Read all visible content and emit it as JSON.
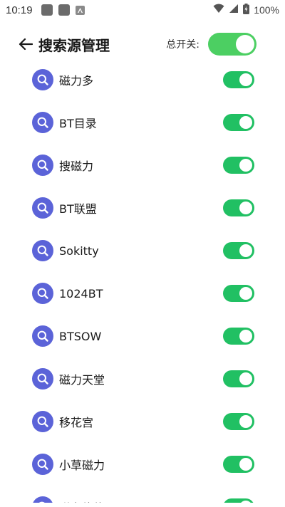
{
  "status_bar": {
    "time": "10:19",
    "battery": "100%"
  },
  "header": {
    "title": "搜索源管理",
    "master_label": "总开关:",
    "master_on": true
  },
  "colors": {
    "toggle_on": "#21c063",
    "master_toggle_on": "#4ccf62",
    "source_icon": "#5b63d8"
  },
  "sources": [
    {
      "name": "磁力多",
      "icon": "search-icon",
      "enabled": true
    },
    {
      "name": "BT目录",
      "icon": "search-icon",
      "enabled": true
    },
    {
      "name": "搜磁力",
      "icon": "search-icon",
      "enabled": true
    },
    {
      "name": "BT联盟",
      "icon": "search-icon",
      "enabled": true
    },
    {
      "name": "Sokitty",
      "icon": "search-icon",
      "enabled": true
    },
    {
      "name": "1024BT",
      "icon": "search-icon",
      "enabled": true
    },
    {
      "name": "BTSOW",
      "icon": "search-icon",
      "enabled": true
    },
    {
      "name": "磁力天堂",
      "icon": "search-icon",
      "enabled": true
    },
    {
      "name": "移花宫",
      "icon": "search-icon",
      "enabled": true
    },
    {
      "name": "小草磁力",
      "icon": "search-icon",
      "enabled": true
    },
    {
      "name": "磁力修修",
      "icon": "search-icon",
      "enabled": true
    }
  ]
}
